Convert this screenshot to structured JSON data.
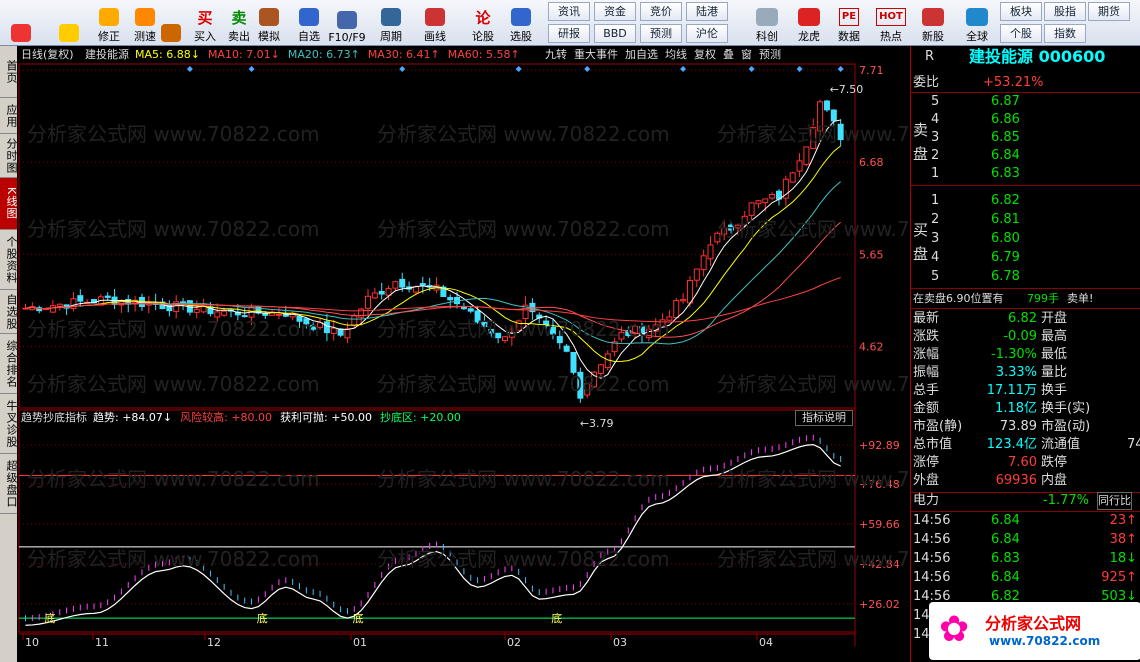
{
  "toolbar": {
    "items": [
      {
        "label": "",
        "icon": "grid-icon"
      },
      {
        "label": "",
        "icon": "back-arrow-icon"
      },
      {
        "label": "修正",
        "icon": "arrow-updown-icon"
      },
      {
        "label": "测速",
        "icon": "speed-icon"
      },
      {
        "label": "",
        "icon": "clock-icon"
      },
      {
        "label": "买入",
        "icon": "buy-icon",
        "glyph": "买"
      },
      {
        "label": "卖出",
        "icon": "sell-icon",
        "glyph": "卖"
      },
      {
        "label": "模拟",
        "icon": "hammer-icon"
      },
      {
        "label": "自选",
        "icon": "folder-icon"
      },
      {
        "label": "F10/F9",
        "icon": "f10-icon"
      },
      {
        "label": "周期",
        "icon": "period-icon"
      },
      {
        "label": "画线",
        "icon": "pencil-icon"
      },
      {
        "label": "论股",
        "icon": "forum-icon",
        "glyph": "论"
      },
      {
        "label": "选股",
        "icon": "magnifier-icon"
      }
    ],
    "small_buttons": [
      [
        "资讯",
        "资金",
        "竞价",
        "陆港"
      ],
      [
        "研报",
        "BBD",
        "预测",
        "沪伦"
      ]
    ],
    "items2": [
      {
        "label": "科创",
        "icon": "chart-icon"
      },
      {
        "label": "龙虎",
        "icon": "dragon-icon"
      },
      {
        "label": "数据",
        "icon": "pe-icon",
        "glyph": "PE"
      },
      {
        "label": "热点",
        "icon": "hot-icon",
        "glyph": "HOT"
      },
      {
        "label": "新股",
        "icon": "new-icon"
      },
      {
        "label": "全球",
        "icon": "globe-icon"
      }
    ],
    "small_buttons2": [
      [
        "板块",
        "个股"
      ],
      [
        "股指",
        "指数"
      ],
      [
        "期货"
      ]
    ]
  },
  "tabs": [
    {
      "label": "首页"
    },
    {
      "label": "应用"
    },
    {
      "label": "分时图"
    },
    {
      "label": "K线图",
      "active": true
    },
    {
      "label": "个股资料"
    },
    {
      "label": "自选股"
    },
    {
      "label": "综合排名"
    },
    {
      "label": "牛叉诊股"
    },
    {
      "label": "超级盘口"
    }
  ],
  "chart": {
    "title": "日线(复权)",
    "stock": "建投能源",
    "ma": [
      {
        "label": "MA5: 6.88↓",
        "color": "#ffff00"
      },
      {
        "label": "MA10: 7.01↓",
        "color": "#ff4040"
      },
      {
        "label": "MA20: 6.73↑",
        "color": "#40c0c0"
      },
      {
        "label": "MA30: 6.41↑",
        "color": "#ff4040"
      },
      {
        "label": "MA60: 5.58↑",
        "color": "#ff4040"
      }
    ],
    "menu": [
      "九转",
      "重大事件",
      "加自选",
      "均线",
      "复权",
      "叠",
      "窗",
      "预测"
    ],
    "price_axis": [
      "7.71",
      "6.68",
      "5.65",
      "4.62"
    ],
    "high_label": "7.50",
    "low_label": "3.79",
    "indicator": {
      "name": "趋势抄底指标",
      "items": [
        {
          "label": "趋势: +84.07↓",
          "color": "#ffffff"
        },
        {
          "label": "风险较高: +80.00",
          "color": "#ff4040"
        },
        {
          "label": "获利可抛: +50.00",
          "color": "#ffffff"
        },
        {
          "label": "抄底区: +20.00",
          "color": "#00ff60"
        }
      ],
      "axis": [
        "+92.89",
        "+76.48",
        "+59.66",
        "+42.84",
        "+26.02"
      ],
      "btn": "指标说明",
      "bottom_labels": [
        "底",
        "底",
        "底",
        "底"
      ]
    },
    "months": [
      "10",
      "11",
      "12",
      "01",
      "02",
      "03",
      "04"
    ]
  },
  "chart_data": {
    "type": "candlestick",
    "high": 7.5,
    "low": 3.79,
    "ylim": [
      4.0,
      7.71
    ]
  },
  "panel": {
    "tag": "R",
    "name": "建投能源",
    "code": "000600",
    "weibi_label": "委比",
    "weibi": "+53.21%",
    "sell_label": [
      "卖",
      "盘"
    ],
    "buy_label": [
      "买",
      "盘"
    ],
    "asks": [
      [
        "5",
        "6.87"
      ],
      [
        "4",
        "6.86"
      ],
      [
        "3",
        "6.85"
      ],
      [
        "2",
        "6.84"
      ],
      [
        "1",
        "6.83"
      ]
    ],
    "bids": [
      [
        "1",
        "6.82"
      ],
      [
        "2",
        "6.81"
      ],
      [
        "3",
        "6.80"
      ],
      [
        "4",
        "6.79"
      ],
      [
        "5",
        "6.78"
      ]
    ],
    "notice": "在卖盘6.90位置有",
    "notice_vol": "799手",
    "notice_tag": "卖单!",
    "stats": [
      [
        "最新",
        "6.82",
        "开盘",
        ""
      ],
      [
        "涨跌",
        "-0.09",
        "最高",
        ""
      ],
      [
        "涨幅",
        "-1.30%",
        "最低",
        ""
      ],
      [
        "振幅",
        "3.33%",
        "量比",
        ""
      ],
      [
        "总手",
        "17.11万",
        "换手",
        ""
      ],
      [
        "金额",
        "1.18亿",
        "换手(实)",
        ""
      ],
      [
        "市盈(静)",
        "73.89",
        "市盈(动)",
        ""
      ],
      [
        "总市值",
        "123.4亿",
        "流通值",
        "74"
      ],
      [
        "涨停",
        "7.60",
        "跌停",
        ""
      ],
      [
        "外盘",
        "69936",
        "内盘",
        ""
      ]
    ],
    "sector": "电力",
    "sector_chg": "-1.77%",
    "sector_btn": "同行比",
    "ticks": [
      [
        "14:56",
        "6.84",
        "23",
        "up"
      ],
      [
        "14:56",
        "6.84",
        "38",
        "up"
      ],
      [
        "14:56",
        "6.83",
        "18",
        "dn"
      ],
      [
        "14:56",
        "6.84",
        "925",
        "up"
      ],
      [
        "14:56",
        "6.82",
        "503",
        "dn"
      ],
      [
        "14:",
        "",
        " ",
        ""
      ],
      [
        "14",
        "",
        " ",
        ""
      ]
    ],
    "logo": "分析家公式网",
    "logo_url": "www.70822.com"
  },
  "watermark": "分析家公式网 www.70822.com"
}
